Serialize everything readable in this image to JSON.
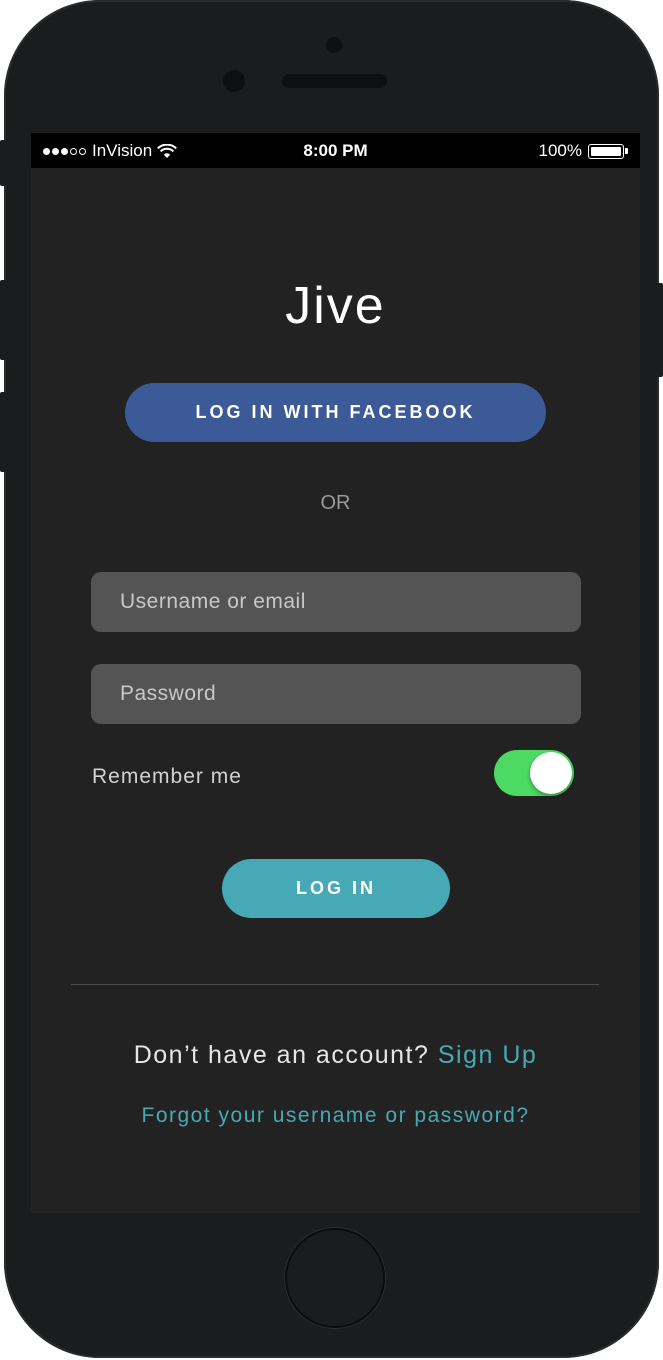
{
  "status_bar": {
    "signal_full": 3,
    "signal_empty": 2,
    "carrier": "InVision",
    "time": "8:00 PM",
    "battery": "100%",
    "icons": [
      "signal-icon",
      "wifi-icon",
      "battery-icon"
    ]
  },
  "app": {
    "title": "Jive"
  },
  "facebook_button": {
    "label": "LOG IN WITH FACEBOOK",
    "color": "#3d5a98"
  },
  "divider_text": "OR",
  "form": {
    "username_placeholder": "Username or email",
    "password_placeholder": "Password",
    "remember_label": "Remember me",
    "remember_on": true,
    "toggle_color": "#4cd964"
  },
  "login_button": {
    "label": "LOG IN",
    "color": "#47a9b5"
  },
  "footer": {
    "signup_prompt": "Don’t have an account?",
    "signup_link": "Sign Up",
    "forgot_link": "Forgot your username or password?",
    "link_color": "#47a9b5"
  }
}
